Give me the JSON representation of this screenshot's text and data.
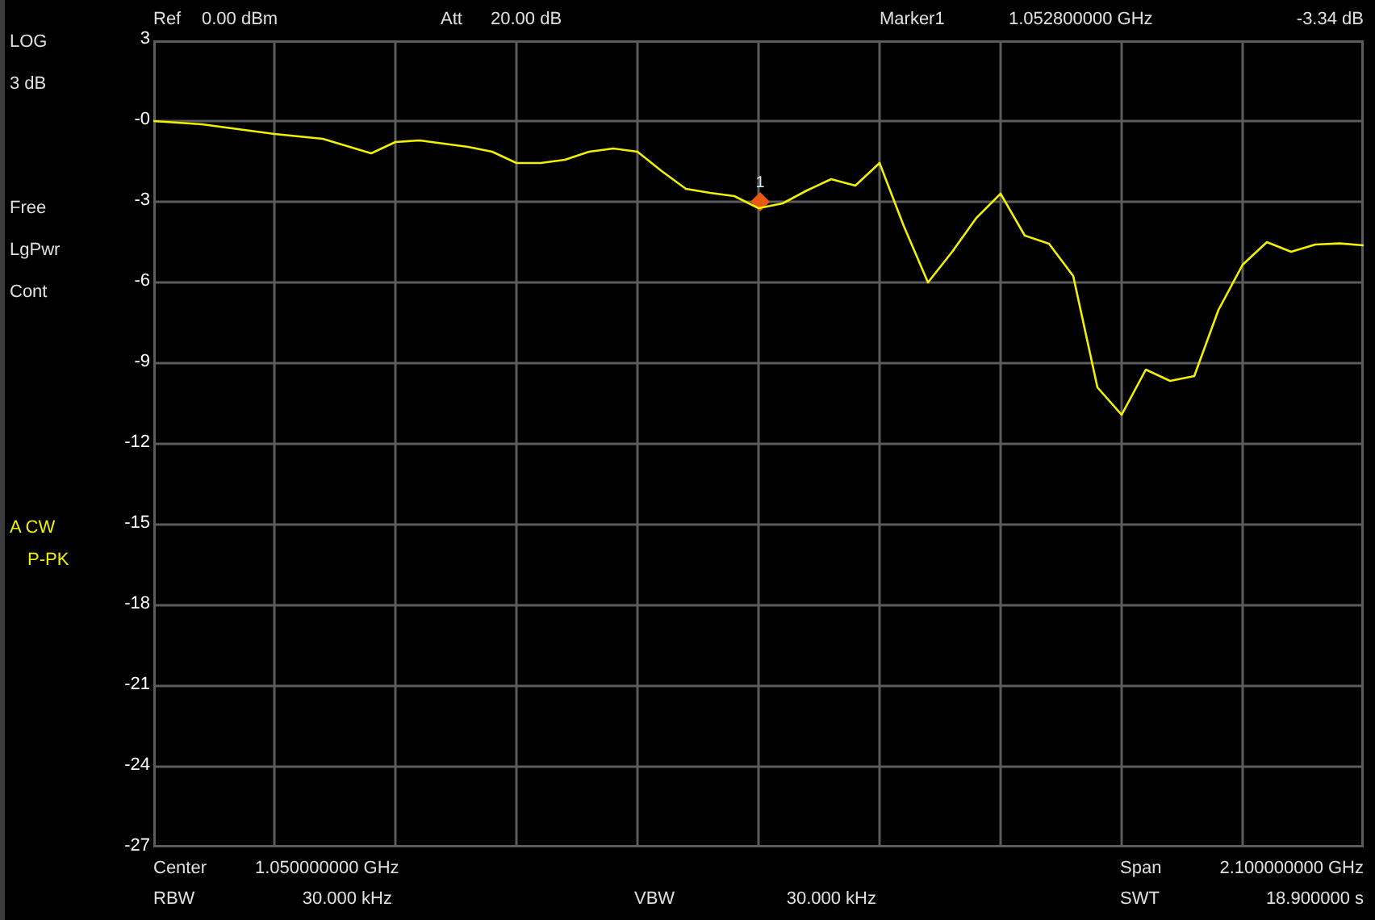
{
  "header": {
    "ref": {
      "label": "Ref",
      "value": "0.00 dBm"
    },
    "att": {
      "label": "Att",
      "value": "20.00 dB"
    },
    "marker": {
      "label": "Marker1",
      "frequency": "1.052800000 GHz",
      "level": "-3.34 dB"
    }
  },
  "left_panel": {
    "scale": [
      "LOG",
      "3 dB"
    ],
    "modes": [
      "Free",
      "LgPwr",
      "Cont"
    ],
    "trace": [
      "A CW",
      "P-PK"
    ]
  },
  "chart_data": {
    "type": "line",
    "grid": true,
    "ylim": [
      -27,
      3
    ],
    "yticks": [
      3,
      {
        "value": 0,
        "label": "-0"
      },
      -3,
      -6,
      -9,
      -12,
      -15,
      -18,
      -21,
      -24,
      -27
    ],
    "categories": [
      null,
      null,
      null,
      null,
      null,
      null,
      null,
      null,
      null,
      null,
      null,
      null,
      null,
      null,
      null,
      null,
      null,
      null,
      null,
      null,
      null,
      null,
      null,
      null,
      null,
      null,
      null,
      null,
      null,
      null,
      null,
      null,
      null,
      null,
      null,
      null,
      null,
      null,
      null,
      null,
      null,
      null,
      null,
      null,
      null,
      null,
      null,
      null,
      null,
      null,
      null
    ],
    "series": [
      {
        "color": "#f0f000",
        "values": [
          0,
          -0.06,
          -0.12,
          -0.24,
          -0.36,
          -0.48,
          -0.57,
          -0.66,
          -0.93,
          -1.2,
          -0.78,
          -0.72,
          -0.84,
          -0.96,
          -1.14,
          -1.56,
          -1.56,
          -1.44,
          -1.14,
          -1.02,
          -1.14,
          -1.86,
          -2.52,
          -2.67,
          -2.79,
          -3.24,
          -3.06,
          -2.58,
          -2.16,
          -2.4,
          -1.56,
          -3.9,
          -6,
          -4.86,
          -3.6,
          -2.7,
          -4.26,
          -4.56,
          -5.76,
          -9.9,
          -10.92,
          -9.24,
          -9.66,
          -9.48,
          -7.02,
          -5.34,
          -4.5,
          -4.86,
          -4.59,
          -4.55,
          -4.62
        ]
      }
    ]
  },
  "trace_marker": {
    "label": "1"
  },
  "footer": {
    "center": {
      "label": "Center",
      "value": "1.050000000 GHz"
    },
    "span": {
      "label": "Span",
      "value": "2.100000000 GHz"
    },
    "rbw": {
      "label": "RBW",
      "value": "30.000 kHz"
    },
    "vbw": {
      "label": "VBW",
      "value": "30.000 kHz"
    },
    "swt": {
      "label": "SWT",
      "value": "18.900000 s"
    }
  }
}
